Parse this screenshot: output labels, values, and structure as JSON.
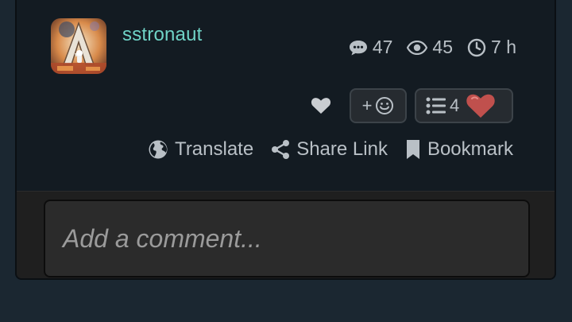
{
  "post": {
    "username": "sstronaut",
    "avatar_icon": "astronaut-avatar",
    "stats": {
      "replies": "47",
      "views": "45",
      "age": "7 h"
    }
  },
  "reactions": {
    "like_icon": "heart-icon",
    "add_reaction_label": "+",
    "list_count": "4",
    "list_icon": "list-icon",
    "reaction_icon": "heart-reaction-icon"
  },
  "actions": {
    "translate": "Translate",
    "share": "Share Link",
    "bookmark": "Bookmark"
  },
  "comment": {
    "placeholder": "Add a comment..."
  },
  "colors": {
    "accent": "#6fd3c6",
    "card": "#131b22",
    "background": "#1b2731",
    "heart": "#c0504d"
  }
}
